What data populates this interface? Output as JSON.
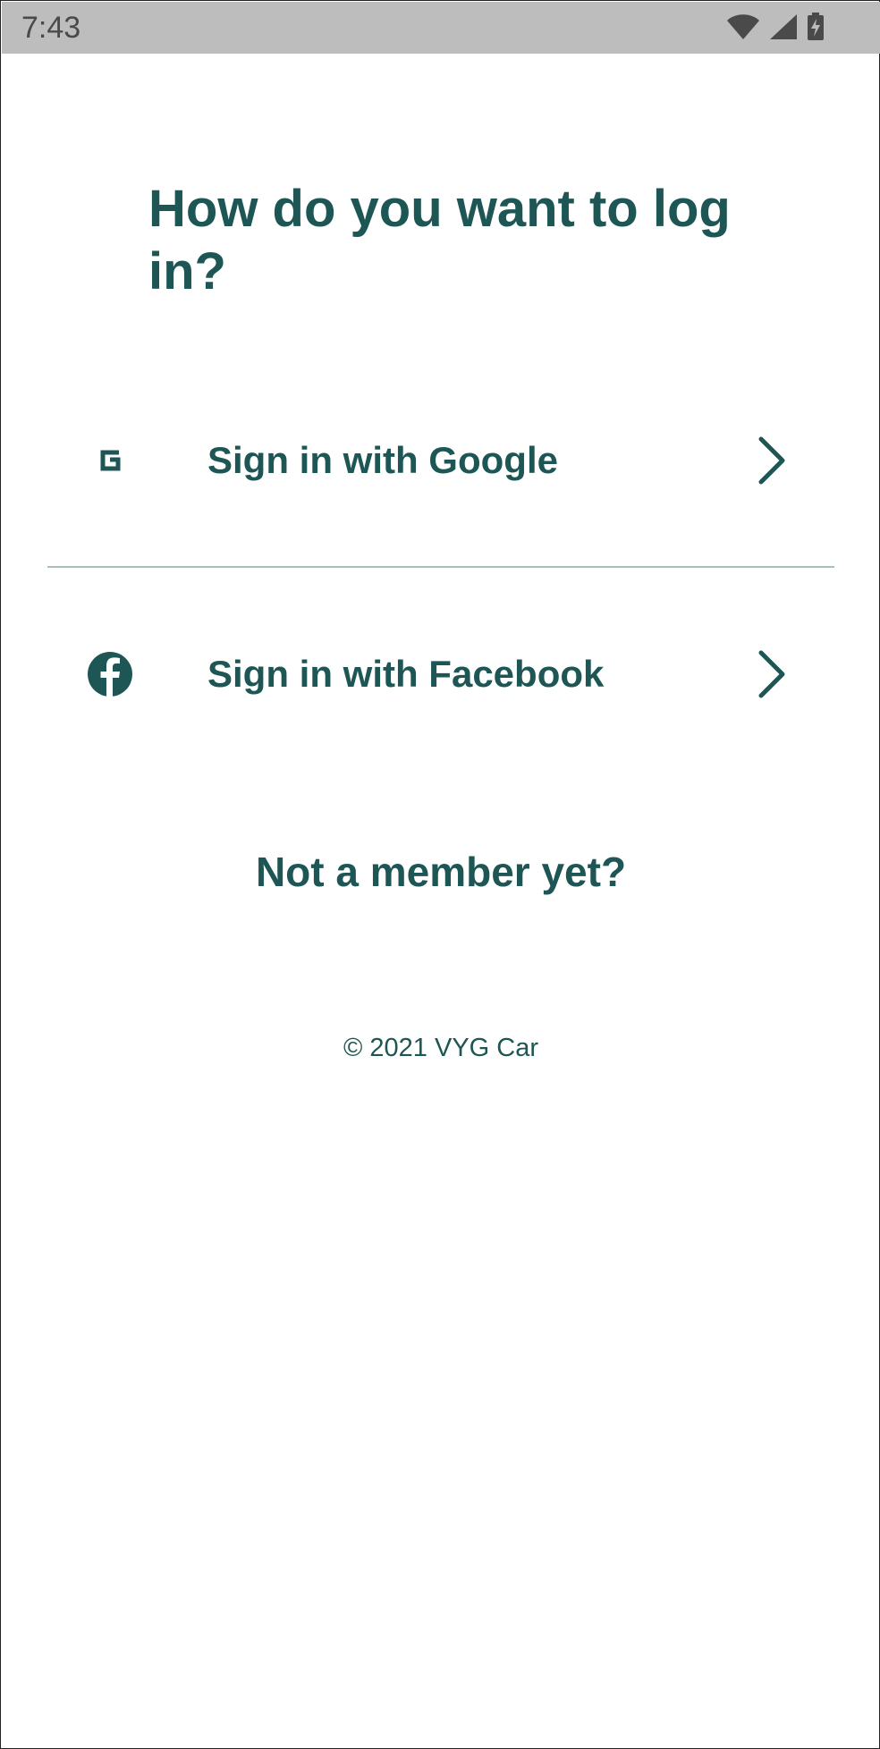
{
  "status_bar": {
    "time": "7:43",
    "icons": [
      "wifi-icon",
      "cell-signal-icon",
      "battery-charging-icon"
    ]
  },
  "login": {
    "title": "How do you want to log in?",
    "options": [
      {
        "label": "Sign in with Google",
        "icon": "google-icon"
      },
      {
        "label": "Sign in with Facebook",
        "icon": "facebook-icon"
      }
    ],
    "not_member": "Not a member yet?",
    "copyright": "© 2021 VYG Car"
  },
  "colors": {
    "primary": "#1d5654",
    "status_bar_bg": "#bdbdbd",
    "divider": "#a9bfbd",
    "background": "#ffffff"
  }
}
